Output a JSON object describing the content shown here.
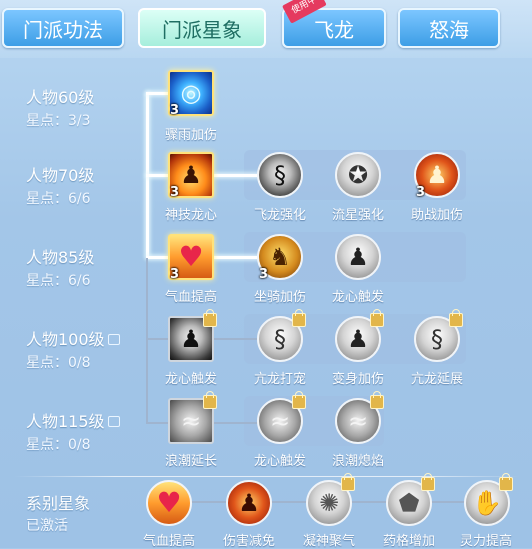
{
  "tabs": [
    {
      "label": "门派功法"
    },
    {
      "label": "门派星象"
    },
    {
      "label": "飞龙",
      "badge": "使用中"
    },
    {
      "label": "怒海"
    }
  ],
  "levels": [
    {
      "title": "人物60级",
      "stars": "星点：3/3"
    },
    {
      "title": "人物70级",
      "stars": "星点：6/6"
    },
    {
      "title": "人物85级",
      "stars": "星点：6/6"
    },
    {
      "title": "人物100级",
      "stars": "星点：0/8"
    },
    {
      "title": "人物115级",
      "stars": "星点：0/8"
    }
  ],
  "series": {
    "title": "系别星象",
    "status": "已激活"
  },
  "nodes": {
    "r1": [
      {
        "label": "骤雨加伤",
        "count": "3",
        "icon": "storm-icon"
      }
    ],
    "r2": [
      {
        "label": "神技龙心",
        "count": "3",
        "icon": "flame-warrior-icon"
      },
      {
        "label": "飞龙强化",
        "icon": "dragon-icon"
      },
      {
        "label": "流星强化",
        "icon": "meteor-icon"
      },
      {
        "label": "助战加伤",
        "count": "3",
        "icon": "fire-figure-icon"
      }
    ],
    "r3": [
      {
        "label": "气血提高",
        "count": "3",
        "icon": "heart-icon"
      },
      {
        "label": "坐骑加伤",
        "count": "3",
        "icon": "beast-icon"
      },
      {
        "label": "龙心触发",
        "icon": "figure-icon"
      }
    ],
    "r4": [
      {
        "label": "龙心触发",
        "icon": "figure-icon"
      },
      {
        "label": "亢龙打宠",
        "icon": "dragon-icon"
      },
      {
        "label": "变身加伤",
        "icon": "swirl-figure-icon"
      },
      {
        "label": "亢龙延展",
        "icon": "dragon-icon"
      }
    ],
    "r5": [
      {
        "label": "浪潮延长",
        "icon": "wave-icon"
      },
      {
        "label": "龙心触发",
        "icon": "wave-icon"
      },
      {
        "label": "浪潮熄焰",
        "icon": "wave-icon"
      }
    ],
    "bottom": [
      {
        "label": "气血提高",
        "icon": "heart-icon"
      },
      {
        "label": "伤害减免",
        "icon": "fire-figure-icon"
      },
      {
        "label": "凝神聚气",
        "icon": "burst-icon"
      },
      {
        "label": "药格增加",
        "icon": "shield-icon"
      },
      {
        "label": "灵力提高",
        "icon": "hand-icon"
      }
    ]
  }
}
